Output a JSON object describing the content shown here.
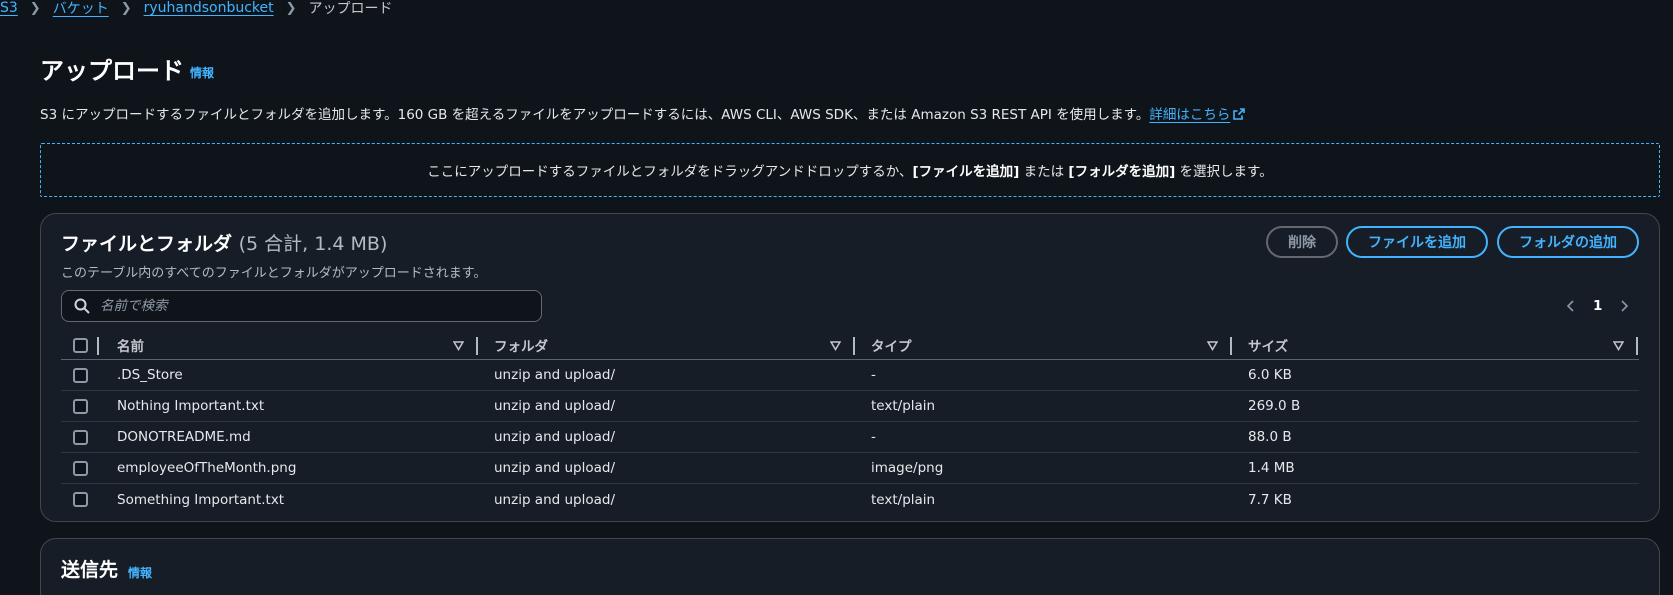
{
  "breadcrumb": {
    "s3": "S3",
    "buckets": "バケット",
    "bucket_name": "ryuhandsonbucket",
    "current": "アップロード"
  },
  "header": {
    "title": "アップロード",
    "info": "情報",
    "description": "S3 にアップロードするファイルとフォルダを追加します。160 GB を超えるファイルをアップロードするには、AWS CLI、AWS SDK、または Amazon S3 REST API を使用します。",
    "learn_more": "詳細はこちら"
  },
  "dropzone": {
    "text_before": "ここにアップロードするファイルとフォルダをドラッグアンドドロップするか、",
    "add_files": "[ファイルを追加]",
    "middle": " または ",
    "add_folder": "[フォルダを追加]",
    "text_after": " を選択します。"
  },
  "files_panel": {
    "title": "ファイルとフォルダ",
    "count": "(5 合計, 1.4 MB)",
    "subtitle": "このテーブル内のすべてのファイルとフォルダがアップロードされます。",
    "delete_label": "削除",
    "add_files_label": "ファイルを追加",
    "add_folder_label": "フォルダの追加",
    "search_placeholder": "名前で検索",
    "page_number": "1",
    "columns": {
      "name": "名前",
      "folder": "フォルダ",
      "type": "タイプ",
      "size": "サイズ"
    },
    "rows": [
      {
        "name": ".DS_Store",
        "folder": "unzip and upload/",
        "type": "-",
        "size": "6.0 KB"
      },
      {
        "name": "Nothing Important.txt",
        "folder": "unzip and upload/",
        "type": "text/plain",
        "size": "269.0 B"
      },
      {
        "name": "DONOTREADME.md",
        "folder": "unzip and upload/",
        "type": "-",
        "size": "88.0 B"
      },
      {
        "name": "employeeOfTheMonth.png",
        "folder": "unzip and upload/",
        "type": "image/png",
        "size": "1.4 MB"
      },
      {
        "name": "Something Important.txt",
        "folder": "unzip and upload/",
        "type": "text/plain",
        "size": "7.7 KB"
      }
    ]
  },
  "destination": {
    "title": "送信先",
    "info": "情報"
  },
  "colors": {
    "background": "#0f141a",
    "panel": "#161d26",
    "accent": "#42b4ff",
    "border": "#424650"
  },
  "icons": {
    "search": "search-icon",
    "external": "external-link-icon",
    "sort": "sort-caret-icon",
    "prev": "chevron-left-icon",
    "next": "chevron-right-icon"
  }
}
